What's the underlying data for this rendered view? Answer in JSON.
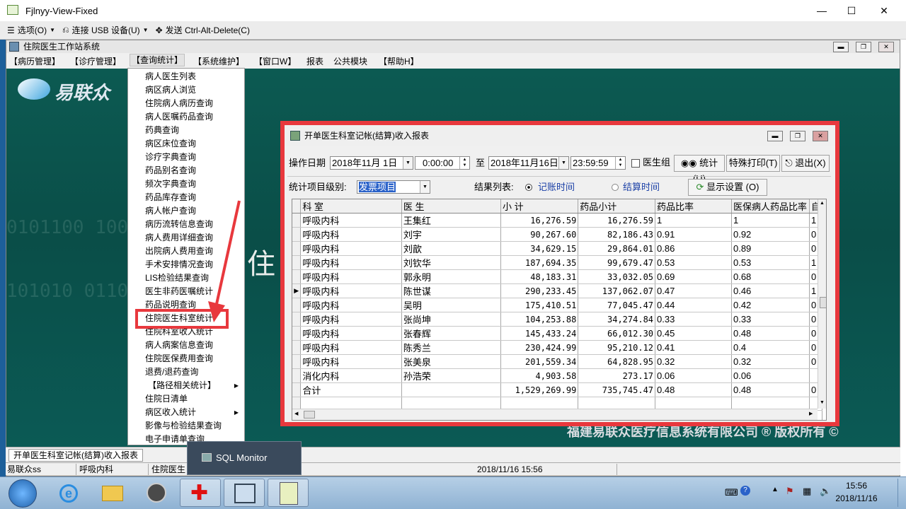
{
  "viewer": {
    "title": "Fjlnyy-View-Fixed",
    "toolbar": {
      "options": "选项(O)",
      "usb": "连接 USB 设备(U)",
      "send_cad": "发送 Ctrl-Alt-Delete(C)"
    }
  },
  "app": {
    "title": "住院医生工作站系统",
    "menus": [
      "【病历管理】",
      "【诊疗管理】",
      "【查询统计】",
      "【系统维护】",
      "【窗口W】",
      "报表",
      "公共模块",
      "【帮助H】"
    ],
    "logo_text": "易联众",
    "bg_text": "住",
    "copyright": "福建易联众医疗信息系统有限公司 ® 版权所有 ©"
  },
  "dropdown": {
    "items": [
      "病人医生列表",
      "病区病人浏览",
      "住院病人病历查询",
      "病人医嘱药品查询",
      "药典查询",
      "病区床位查询",
      "诊疗字典查询",
      "药品别名查询",
      "频次字典查询",
      "药品库存查询",
      "病人帐户查询",
      "病历流转信息查询",
      "病人费用详细查询",
      "出院病人费用查询",
      "手术安排情况查询",
      "LIS检验结果查询",
      "医生非药医嘱统计",
      "药品说明查询",
      "住院医生科室统计",
      "住院科室收入统计",
      "病人病案信息查询",
      "住院医保费用查询",
      "退费/退药查询",
      "【路径相关统计】",
      "住院日清单",
      "病区收入统计",
      "影像与检验结果查询",
      "电子申请单查询"
    ]
  },
  "dialog": {
    "title": "开单医生科室记帐(结算)收入报表",
    "op_date_label": "操作日期",
    "date_from": "2018年11月 1日",
    "time_from": "0:00:00",
    "to_label": "至",
    "date_to": "2018年11月16日",
    "time_to": "23:59:59",
    "doctor_group_label": "医生组",
    "stats_button": "统计 (U)",
    "print_button": "特殊打印(T)",
    "exit_button": "退出(X)",
    "level_label": "统计项目级别:",
    "level_value": "发票项目",
    "result_label": "结果列表:",
    "radio_billing": "记账时间",
    "radio_settle": "结算时间",
    "display_button": "显示设置 (O)",
    "columns": [
      "科 室",
      "医 生",
      "小 计",
      "药品小计",
      "药品比率",
      "医保病人药品比率",
      "自"
    ],
    "rows": [
      [
        "呼吸内科",
        "王集红",
        "16,276.59",
        "16,276.59",
        "1",
        "1",
        "1"
      ],
      [
        "呼吸内科",
        "刘宇",
        "90,267.60",
        "82,186.43",
        "0.91",
        "0.92",
        "0"
      ],
      [
        "呼吸内科",
        "刘歆",
        "34,629.15",
        "29,864.01",
        "0.86",
        "0.89",
        "0"
      ],
      [
        "呼吸内科",
        "刘钦华",
        "187,694.35",
        "99,679.47",
        "0.53",
        "0.53",
        "1"
      ],
      [
        "呼吸内科",
        "郭永明",
        "48,183.31",
        "33,032.05",
        "0.69",
        "0.68",
        "0"
      ],
      [
        "呼吸内科",
        "陈世谋",
        "290,233.45",
        "137,062.07",
        "0.47",
        "0.46",
        "1"
      ],
      [
        "呼吸内科",
        "吴明",
        "175,410.51",
        "77,045.47",
        "0.44",
        "0.42",
        "0"
      ],
      [
        "呼吸内科",
        "张尚坤",
        "104,253.88",
        "34,274.84",
        "0.33",
        "0.33",
        "0"
      ],
      [
        "呼吸内科",
        "张春辉",
        "145,433.24",
        "66,012.30",
        "0.45",
        "0.48",
        "0"
      ],
      [
        "呼吸内科",
        "陈秀兰",
        "230,424.99",
        "95,210.12",
        "0.41",
        "0.4",
        "0"
      ],
      [
        "呼吸内科",
        "张美泉",
        "201,559.34",
        "64,828.95",
        "0.32",
        "0.32",
        "0"
      ],
      [
        "消化内科",
        "孙浩荣",
        "4,903.58",
        "273.17",
        "0.06",
        "0.06",
        ""
      ],
      [
        "合计",
        "",
        "1,529,269.99",
        "735,745.47",
        "0.48",
        "0.48",
        "0"
      ]
    ],
    "current_row_index": 5
  },
  "mdi_tab": "开单医生科室记帐(结算)收入报表",
  "sql_popup": "SQL Monitor",
  "status": {
    "user": "易联众ss",
    "dept": "呼吸内科",
    "station": "住院医生",
    "datetime": "2018/11/16 15:56"
  },
  "taskbar": {
    "time": "15:56",
    "date": "2018/11/16"
  },
  "colors": {
    "highlight_red": "#e8383d",
    "workspace_teal": "#0c5a52",
    "taskbar_blue": "#8fb2d3"
  }
}
